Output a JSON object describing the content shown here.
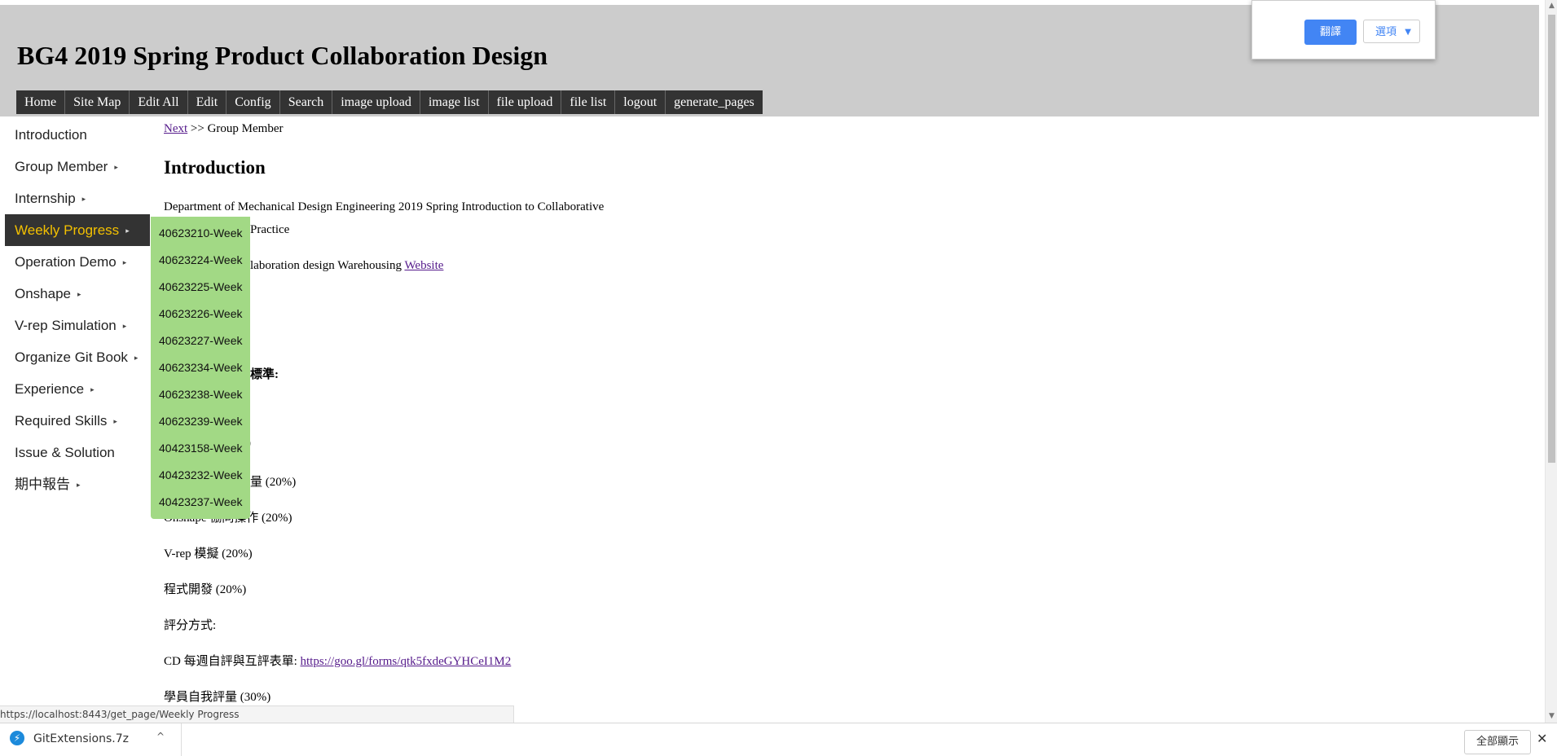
{
  "header": {
    "title": "BG4 2019 Spring Product Collaboration Design",
    "nav": [
      "Home",
      "Site Map",
      "Edit All",
      "Edit",
      "Config",
      "Search",
      "image upload",
      "image list",
      "file upload",
      "file list",
      "logout",
      "generate_pages"
    ]
  },
  "sidebar": {
    "items": [
      {
        "label": "Introduction",
        "caret": false
      },
      {
        "label": "Group Member",
        "caret": true
      },
      {
        "label": "Internship",
        "caret": true
      },
      {
        "label": "Weekly Progress",
        "caret": true,
        "active": true
      },
      {
        "label": "Operation Demo",
        "caret": true
      },
      {
        "label": "Onshape",
        "caret": true
      },
      {
        "label": "V-rep Simulation",
        "caret": true
      },
      {
        "label": "Organize Git Book",
        "caret": true
      },
      {
        "label": "Experience",
        "caret": true
      },
      {
        "label": "Required Skills",
        "caret": true
      },
      {
        "label": "Issue & Solution",
        "caret": false
      },
      {
        "label": "期中報告",
        "caret": true
      }
    ],
    "caret_glyph": "▸"
  },
  "submenu": {
    "items": [
      "40623210-Week",
      "40623224-Week",
      "40623225-Week",
      "40623226-Week",
      "40623227-Week",
      "40623234-Week",
      "40623238-Week",
      "40623239-Week",
      "40423158-Week",
      "40423232-Week",
      "40423237-Week"
    ]
  },
  "content": {
    "breadcrumb_link": "Next",
    "breadcrumb_rest": ">> Group Member",
    "heading": "Introduction",
    "para1_line1": "Department of Mechanical Design Engineering 2019 Spring Introduction to Collaborative",
    "para1_line2_visible": "Practice",
    "para2_visible": "laboration design Warehousing",
    "para2_link": "Website",
    "criteria_visible": "標準:",
    "pct_fragment": ")",
    "item_partial": "量 (20%)",
    "item_onshape": "Onshape 協同操作 (20%)",
    "item_vrep": "V-rep 模擬 (20%)",
    "item_program": "程式開發 (20%)",
    "grading_method": "評分方式:",
    "cd_label": "CD 每週自評與互評表單:",
    "cd_link": "https://goo.gl/forms/qtk5fxdeGYHCeI1M2",
    "self_eval": "學員自我評量 (30%)"
  },
  "translate_popup": {
    "translate_label": "翻譯",
    "options_label": "選項"
  },
  "statusbar": {
    "url": "https://localhost:8443/get_page/Weekly Progress"
  },
  "downloads": {
    "file_name": "GitExtensions.7z",
    "show_all_label": "全部顯示",
    "close_glyph": "✕",
    "caret_glyph": "^"
  },
  "colors": {
    "header_bg": "#cccccc",
    "nav_bg": "#333333",
    "active_bg": "#333333",
    "active_text": "#f3c000",
    "submenu_bg": "#a2d985",
    "translate_blue": "#4285f4"
  }
}
